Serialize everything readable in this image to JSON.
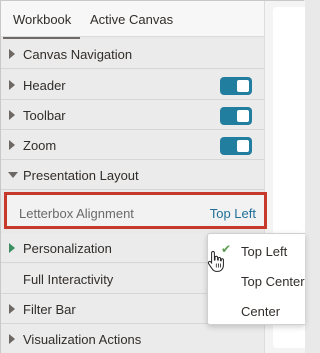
{
  "tabs": [
    {
      "label": "Workbook",
      "active": true
    },
    {
      "label": "Active Canvas",
      "active": false
    }
  ],
  "sections": [
    {
      "label": "Canvas Navigation",
      "arrow": "collapsed"
    },
    {
      "label": "Header",
      "arrow": "collapsed",
      "toggle": true
    },
    {
      "label": "Toolbar",
      "arrow": "collapsed",
      "toggle": true
    },
    {
      "label": "Zoom",
      "arrow": "collapsed",
      "toggle": true
    },
    {
      "label": "Presentation Layout",
      "arrow": "expanded"
    },
    {
      "label": "Personalization",
      "arrow": "collapsed"
    },
    {
      "label": "Full Interactivity",
      "arrow": "none"
    },
    {
      "label": "Filter Bar",
      "arrow": "collapsed"
    },
    {
      "label": "Visualization Actions",
      "arrow": "collapsed"
    }
  ],
  "letterbox": {
    "label": "Letterbox Alignment",
    "value": "Top Left"
  },
  "dropdown": {
    "options": [
      {
        "label": "Top Left",
        "selected": true
      },
      {
        "label": "Top Center",
        "selected": false
      },
      {
        "label": "Center",
        "selected": false
      }
    ]
  },
  "colors": {
    "toggle_on": "#227e9e",
    "highlight_border": "#c7392b",
    "link_value": "#1f6f99",
    "check": "#5a9a4f"
  }
}
